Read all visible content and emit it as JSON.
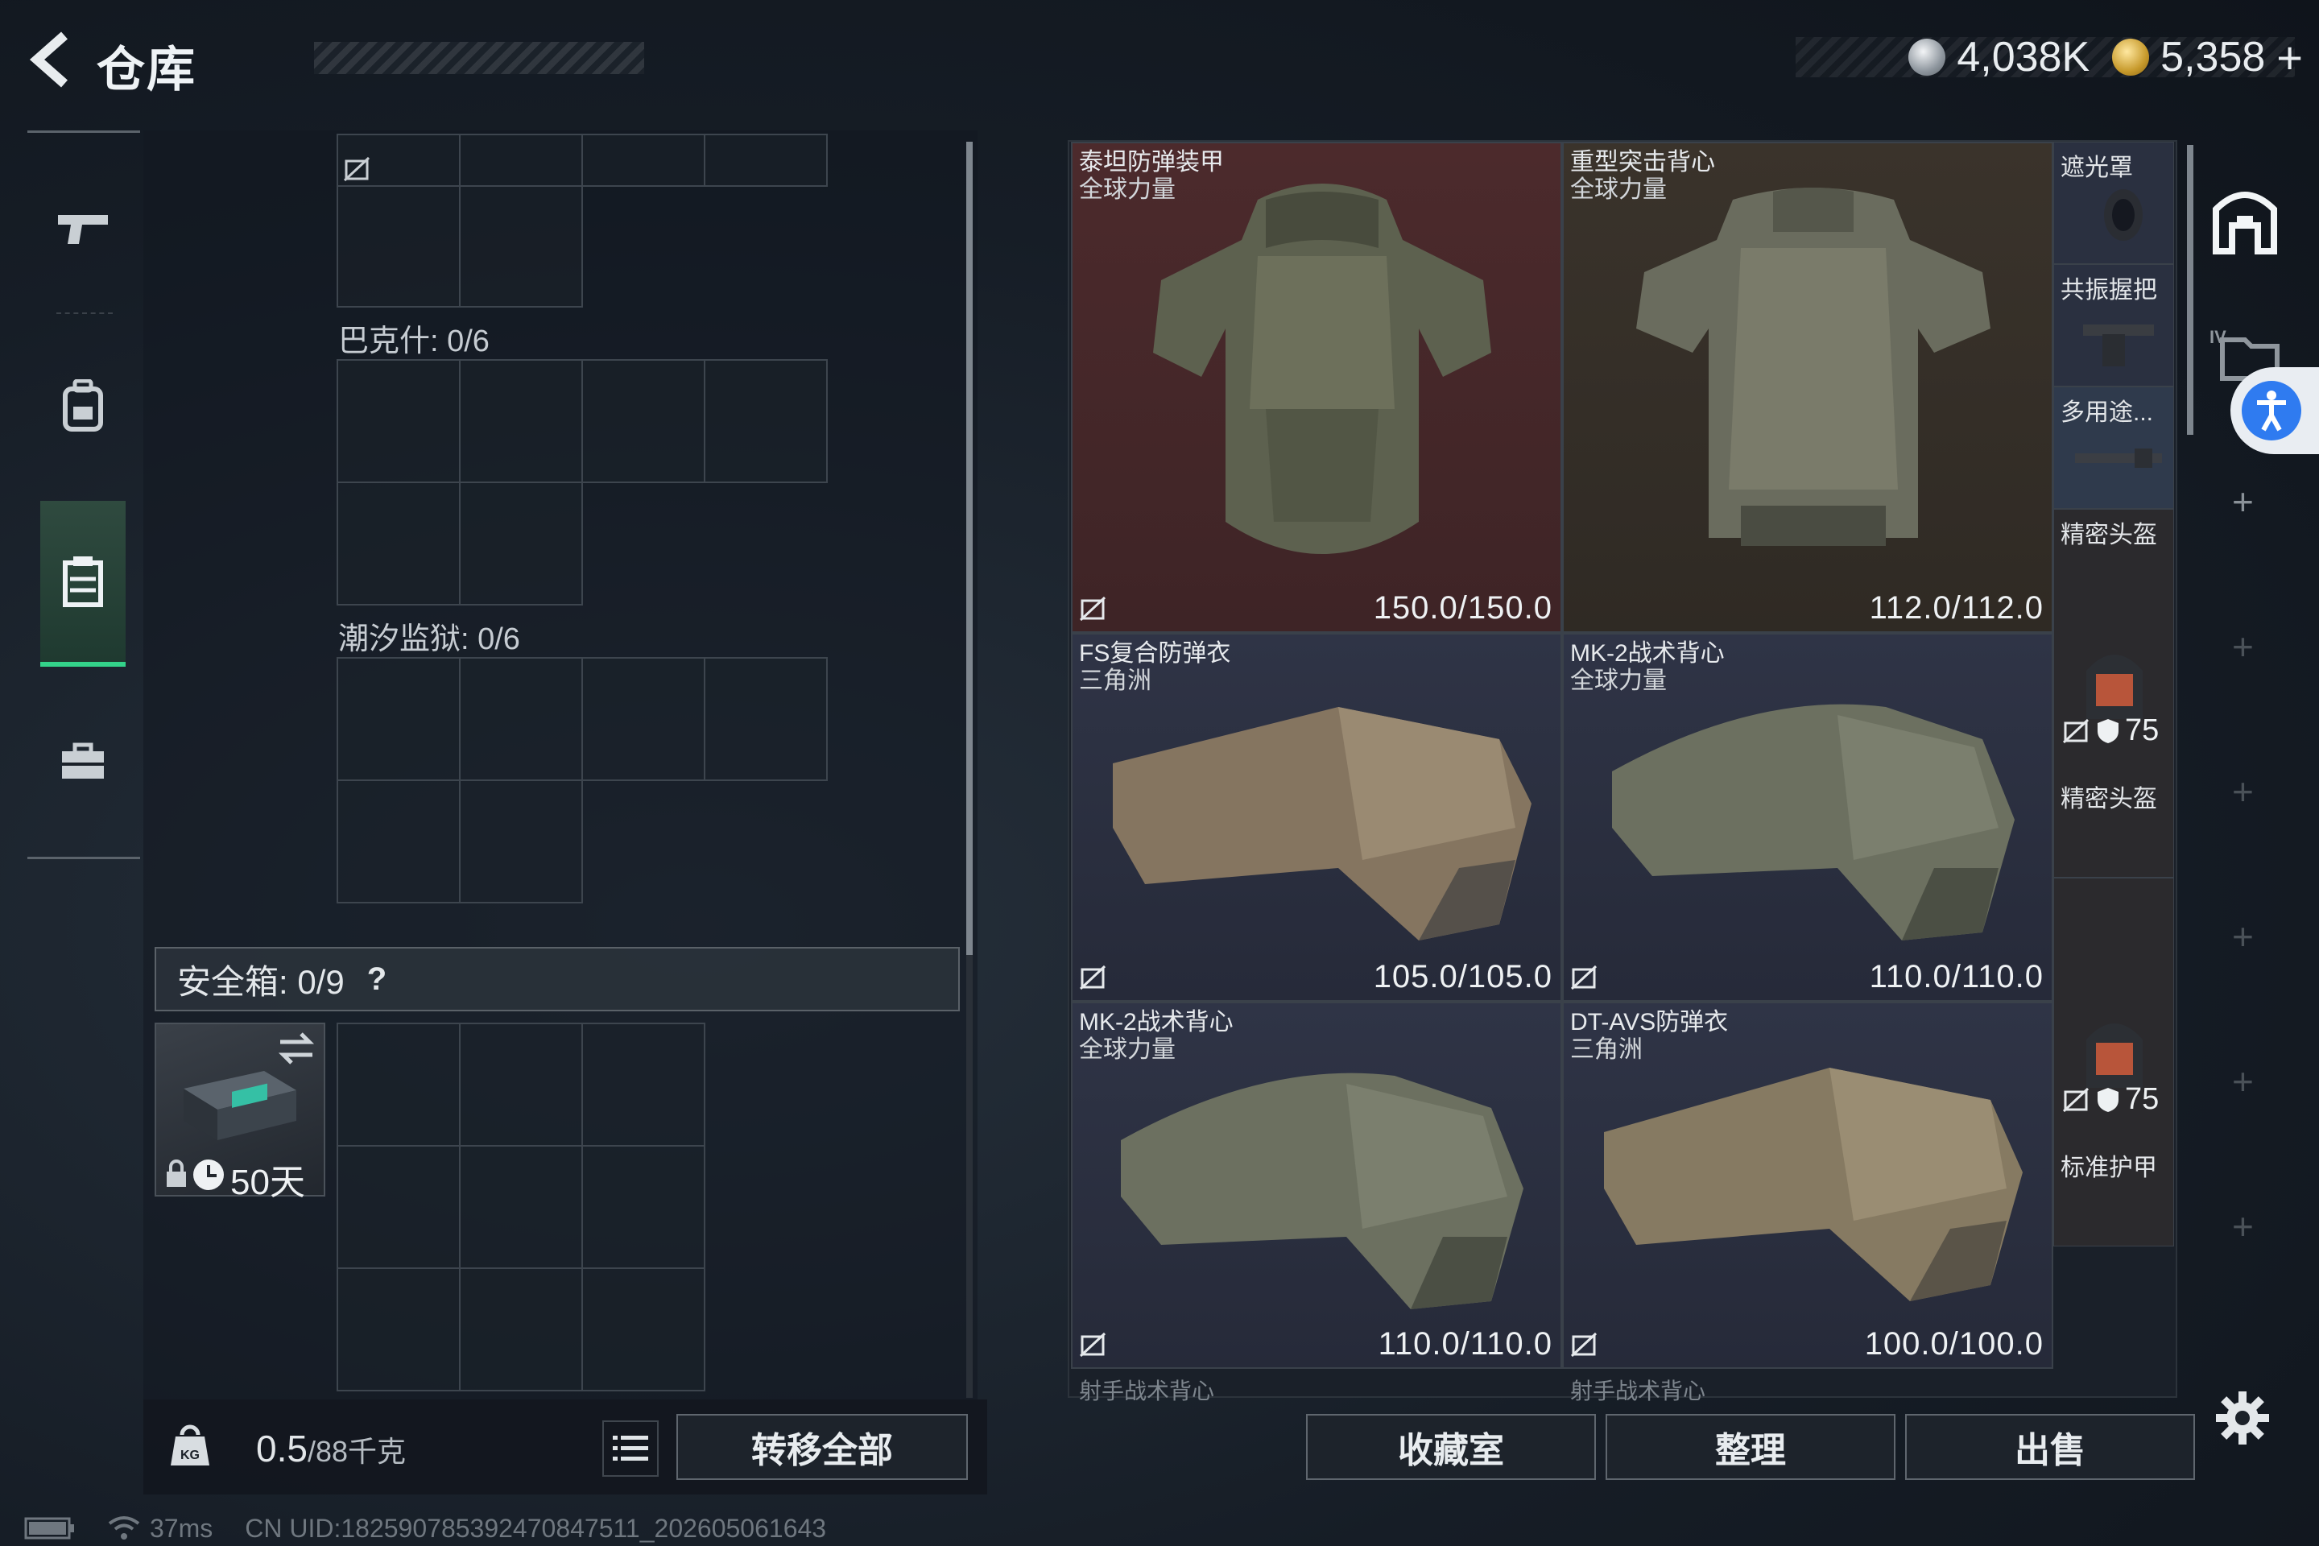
{
  "header": {
    "title": "仓库",
    "currencies": [
      {
        "name": "silver-coin",
        "value": "4,038K"
      },
      {
        "name": "gold-coin",
        "value": "5,358",
        "suffix": "+"
      }
    ]
  },
  "nav": {
    "items": [
      {
        "name": "weapons",
        "icon": "pistol-icon"
      },
      {
        "name": "equipment",
        "icon": "backpack-icon"
      },
      {
        "name": "armor",
        "icon": "vest-icon",
        "active": true
      },
      {
        "name": "misc",
        "icon": "briefcase-icon"
      }
    ]
  },
  "stash": {
    "sections": [
      {
        "label": "巴克什: 0/6"
      },
      {
        "label": "潮汐监狱: 0/6"
      }
    ],
    "safe_box": {
      "label": "安全箱: 0/9",
      "help": "?",
      "days": "50天"
    },
    "weight": {
      "value": "0.5",
      "unit": "/88千克"
    },
    "transfer_all": "转移全部"
  },
  "items": [
    {
      "name": "泰坦防弹装甲",
      "sub": "全球力量",
      "durability": "150.0/150.0",
      "rarity": "red"
    },
    {
      "name": "重型突击背心",
      "sub": "全球力量",
      "durability": "112.0/112.0",
      "rarity": "brown"
    },
    {
      "name": "FS复合防弹衣",
      "sub": "三角洲",
      "durability": "105.0/105.0",
      "rarity": "blue"
    },
    {
      "name": "MK-2战术背心",
      "sub": "全球力量",
      "durability": "110.0/110.0",
      "rarity": "blue"
    },
    {
      "name": "MK-2战术背心",
      "sub": "全球力量",
      "durability": "110.0/110.0",
      "rarity": "blue"
    },
    {
      "name": "DT-AVS防弹衣",
      "sub": "三角洲",
      "durability": "100.0/100.0",
      "rarity": "blue"
    }
  ],
  "side_items": [
    {
      "name": "遮光罩"
    },
    {
      "name": "共振握把"
    },
    {
      "name": "多用途..."
    },
    {
      "name": "精密头盔"
    },
    {
      "name": "精密头盔",
      "stat": "75"
    },
    {
      "name": "标准护甲",
      "stat": "75"
    }
  ],
  "cut_labels": [
    "射手战术背心",
    "射手战术背心"
  ],
  "actions": {
    "collection": "收藏室",
    "organize": "整理",
    "sell": "出售"
  },
  "status": {
    "ping": "37ms",
    "uid": "CN UID:18259078539247084751​1_202605061643"
  }
}
